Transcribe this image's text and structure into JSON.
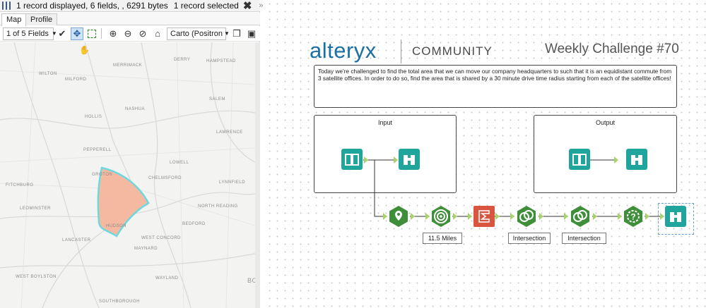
{
  "results": {
    "status": "1 record displayed, 6 fields, , 6291 bytes",
    "selected": "1 record selected",
    "more": "»",
    "tabs": [
      "Map",
      "Profile"
    ],
    "fields_select": "1 of 5 Fields",
    "basemap_select": "Carto (Positron"
  },
  "map": {
    "towns": [
      "WILTON",
      "MILFORD",
      "MERRIMACK",
      "DERRY",
      "HAMPSTEAD",
      "HOLLIS",
      "NASHUA",
      "SALEM",
      "LAWRENCE",
      "PEPPERELL",
      "LOWELL",
      "FITCHBURG",
      "CHELMSFORD",
      "LEOMINSTER",
      "NORTH READING",
      "LANCASTER",
      "WEST CONCORD",
      "MAYNARD",
      "HUDSON",
      "WAYLAND",
      "WEST BOYLSTON",
      "SOUTHBOROUGH",
      "LYNNFIELD",
      "BEDFORD",
      "GROTON",
      "BO"
    ],
    "polygon_color": "#f4b9a0",
    "polygon_stroke": "#6fd8dd"
  },
  "canvas": {
    "logo": "alteryx",
    "community": "COMMUNITY",
    "title": "Weekly Challenge #70",
    "description": "Today we're challenged to find the total area that we can move our company headquarters to such that it is an equidistant commute from 3 satellite offices. In order to do so, find the area that is shared by a 30 minute drive time radius starting from each of the satellite offices!",
    "input_label": "Input",
    "output_label": "Output",
    "labels": [
      "11.5 Miles",
      "Intersection",
      "Intersection"
    ]
  },
  "colors": {
    "teal_tool": "#1fa59b",
    "green_tool": "#3f8f3a",
    "red_tool": "#d9553f",
    "connector": "#9fcf5f"
  }
}
